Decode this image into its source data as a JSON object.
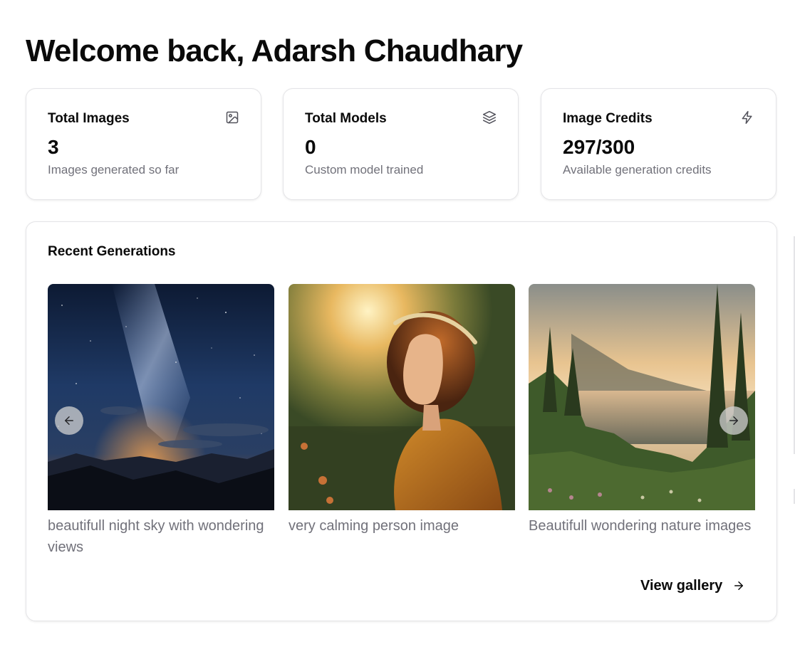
{
  "header": {
    "title": "Welcome back, Adarsh Chaudhary"
  },
  "stats": [
    {
      "label": "Total Images",
      "value": "3",
      "sub": "Images generated so far",
      "icon": "image-icon"
    },
    {
      "label": "Total Models",
      "value": "0",
      "sub": "Custom model trained",
      "icon": "layers-icon"
    },
    {
      "label": "Image Credits",
      "value": "297/300",
      "sub": "Available generation credits",
      "icon": "zap-icon"
    }
  ],
  "recent": {
    "title": "Recent Generations",
    "items": [
      {
        "caption": "beautifull night sky with wondering views"
      },
      {
        "caption": "very calming person image"
      },
      {
        "caption": "Beautifull wondering nature images"
      }
    ],
    "prev_icon": "arrow-left-icon",
    "next_icon": "arrow-right-icon",
    "gallery_label": "View gallery",
    "gallery_icon": "arrow-right-icon"
  },
  "colors": {
    "text": "#0a0a0a",
    "muted": "#71717a",
    "border": "#e4e4e7",
    "background": "#ffffff"
  }
}
